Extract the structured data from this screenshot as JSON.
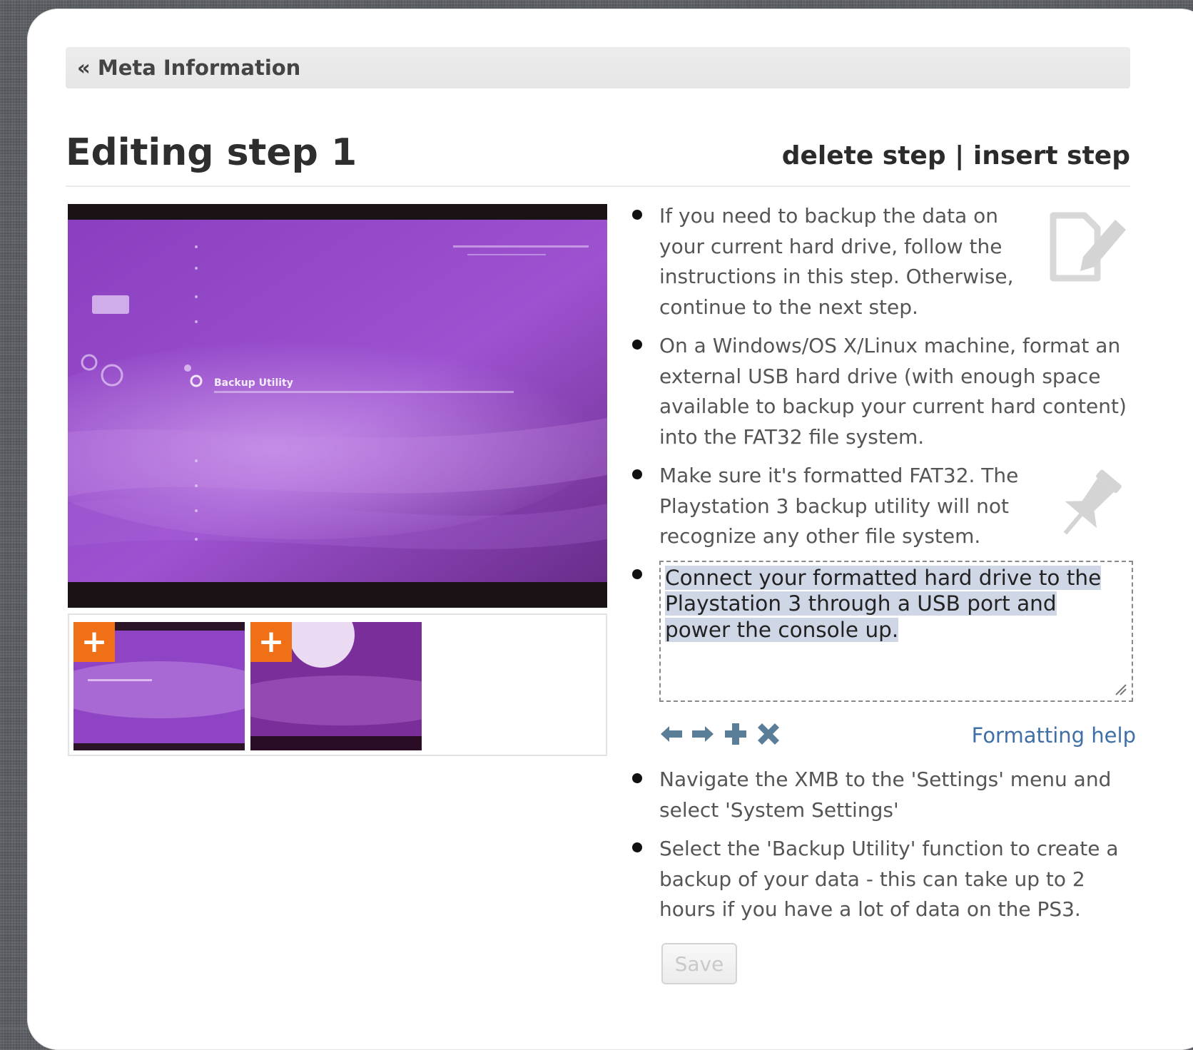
{
  "meta_link": "« Meta Information",
  "title": "Editing step 1",
  "actions": {
    "delete": "delete step",
    "separator": "|",
    "insert": "insert step"
  },
  "bullets": [
    "If you need to backup the data on your current hard drive, follow the instructions in this step. Otherwise, continue to the next step.",
    "On a Windows/OS X/Linux machine, format an external USB hard drive (with enough space available to backup your current hard content) into the FAT32 file system.",
    "Make sure it's formatted FAT32. The Playstation 3 backup utility will not recognize any other file system."
  ],
  "editing_bullet": "Connect your formatted hard drive to the Playstation 3 through a USB port and power the console up.",
  "toolbar": {
    "icons": [
      "arrow-left-icon",
      "arrow-right-icon",
      "add-bullet-icon",
      "delete-bullet-icon"
    ],
    "help": "Formatting help"
  },
  "bullets_after": [
    "Navigate the XMB to the 'Settings' menu and select 'System Settings'",
    "Select the 'Backup Utility' function to create a backup of your data - this can take up to 2 hours if you have a lot of data on the PS3."
  ],
  "image_caption": "Backup Utility",
  "thumb_badge": "+",
  "save_label": "Save",
  "colors": {
    "accent_orange": "#f07018",
    "link_blue": "#3f6fa6",
    "selection": "#cfd6e6",
    "screen_purple": "#9a48c8"
  }
}
